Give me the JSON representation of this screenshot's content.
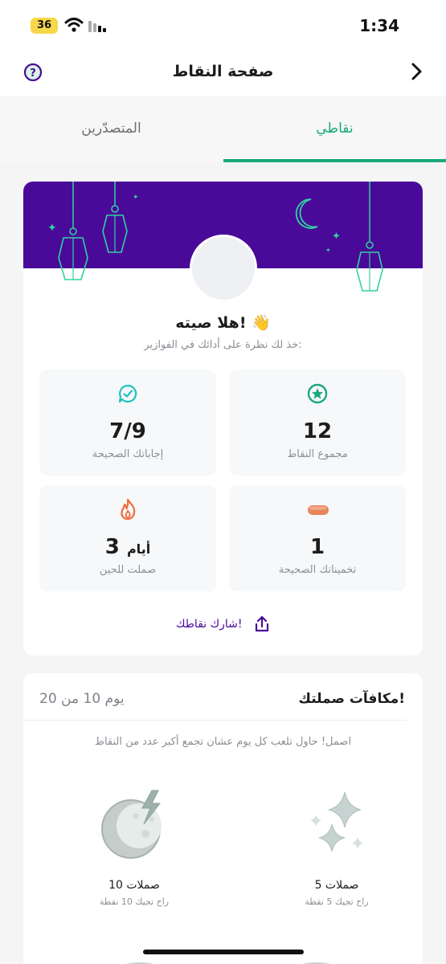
{
  "status_bar": {
    "time": "1:34",
    "battery": "36"
  },
  "header": {
    "title": "صفحة النقاط"
  },
  "tabs": [
    {
      "label": "نقاطي",
      "active": true
    },
    {
      "label": "المتصدّرين",
      "active": false
    }
  ],
  "profile": {
    "greeting": "هلا صيته! 👋",
    "subtitle": "خذ لك نظرة على أدائك في الفوازير:"
  },
  "stats": {
    "total_points": {
      "value": "12",
      "label": "مجموع النقاط",
      "icon": "star-badge-icon"
    },
    "correct_answers": {
      "value": "7/9",
      "label": "إجاباتك الصحيحة",
      "icon": "chat-check-icon"
    },
    "correct_guesses": {
      "value": "1",
      "label": "تخميناتك الصحيحة",
      "icon": "date-icon"
    },
    "streak": {
      "value": "3",
      "unit": "أيام",
      "label": "صملت للحين",
      "icon": "flame-icon"
    }
  },
  "share": {
    "label": "شارك نقاطك!"
  },
  "rewards": {
    "title": "مكافآت صملتك!",
    "day_progress": "يوم 10 من 20",
    "description": "اصمل! حاول تلعب كل يوم عشان تجمع أكبر عدد من النقاط",
    "items": [
      {
        "name": "5 صملات",
        "points": "راح تجيك 5 نقطة",
        "icon": "sparkles-icon"
      },
      {
        "name": "10 صملات",
        "points": "راح تجيك 10 نقطة",
        "icon": "moon-lightning-icon"
      }
    ]
  },
  "colors": {
    "brand_purple": "#4a0a99",
    "accent_green": "#1aa97c",
    "flame_orange": "#f06a3a"
  }
}
